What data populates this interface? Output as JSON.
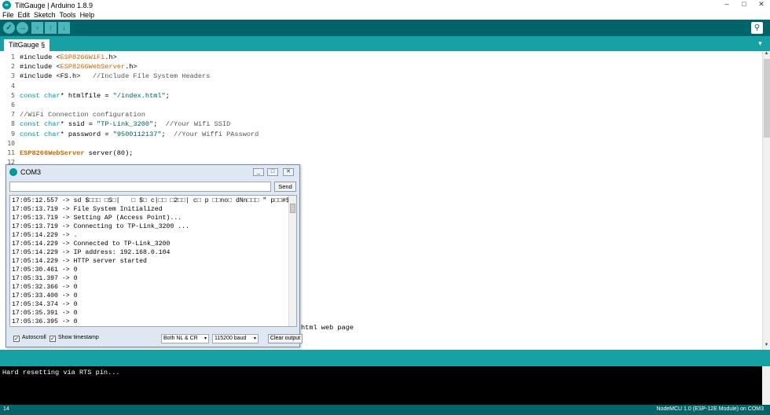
{
  "window": {
    "title": "TiltGauge | Arduino 1.8.9",
    "logo": "∞",
    "controls": [
      "–",
      "□",
      "✕"
    ]
  },
  "menu": [
    "File",
    "Edit",
    "Sketch",
    "Tools",
    "Help"
  ],
  "toolbar": {
    "verify_icon": "✓",
    "upload_icon": "→",
    "new_icon": "▫",
    "open_icon": "↑",
    "save_icon": "↓",
    "serial_monitor_icon": "⚲"
  },
  "tabs": [
    {
      "label": "TiltGauge §"
    }
  ],
  "tab_menu_icon": "▾",
  "editor": {
    "line_numbers": [
      "1",
      "2",
      "3",
      "4",
      "5",
      "6",
      "7",
      "8",
      "9",
      "10",
      "11",
      "12"
    ],
    "lines": [
      {
        "parts": [
          {
            "t": "#include <",
            "c": ""
          },
          {
            "t": "ESP8266WiFi",
            "c": "kw-lib"
          },
          {
            "t": ".h>",
            "c": ""
          }
        ]
      },
      {
        "parts": [
          {
            "t": "#include <",
            "c": ""
          },
          {
            "t": "ESP8266WebServer",
            "c": "kw-lib"
          },
          {
            "t": ".h>",
            "c": ""
          }
        ]
      },
      {
        "parts": [
          {
            "t": "#include <FS.h>   ",
            "c": ""
          },
          {
            "t": "//Include File System Headers",
            "c": "comment"
          }
        ]
      },
      {
        "parts": []
      },
      {
        "parts": [
          {
            "t": "const",
            "c": "kw-const"
          },
          {
            "t": " ",
            "c": ""
          },
          {
            "t": "char",
            "c": "kw-const"
          },
          {
            "t": "* htmlfile = ",
            "c": ""
          },
          {
            "t": "\"/index.html\"",
            "c": "str"
          },
          {
            "t": ";",
            "c": ""
          }
        ]
      },
      {
        "parts": []
      },
      {
        "parts": [
          {
            "t": "//WiFi Connection configuration",
            "c": "comment"
          }
        ]
      },
      {
        "parts": [
          {
            "t": "const",
            "c": "kw-const"
          },
          {
            "t": " ",
            "c": ""
          },
          {
            "t": "char",
            "c": "kw-const"
          },
          {
            "t": "* ssid = ",
            "c": ""
          },
          {
            "t": "\"TP-Link_3200\"",
            "c": "str"
          },
          {
            "t": ";  ",
            "c": ""
          },
          {
            "t": "//Your Wifi SSID",
            "c": "comment"
          }
        ]
      },
      {
        "parts": [
          {
            "t": "const",
            "c": "kw-const"
          },
          {
            "t": " ",
            "c": ""
          },
          {
            "t": "char",
            "c": "kw-const"
          },
          {
            "t": "* password = ",
            "c": ""
          },
          {
            "t": "\"9500112137\"",
            "c": "str"
          },
          {
            "t": ";  ",
            "c": ""
          },
          {
            "t": "//Your Wiffi PAssword",
            "c": "comment"
          }
        ]
      },
      {
        "parts": []
      },
      {
        "parts": [
          {
            "t": "ESP8266WebServer",
            "c": "kw-class"
          },
          {
            "t": " server(80);",
            "c": ""
          }
        ]
      },
      {
        "parts": []
      }
    ],
    "partial_line_text": "html web page"
  },
  "console": {
    "text": "Hard resetting via RTS pin..."
  },
  "status": {
    "line": "14",
    "board": "NodeMCU 1.0 (ESP-12E Module) on COM3"
  },
  "serial_monitor": {
    "title": "COM3",
    "controls": [
      "_",
      "□",
      "✕"
    ],
    "send_label": "Send",
    "input_value": "",
    "lines": [
      "17:05:12.557 -> sd $□□□ □S□|   □ $□ c|□□ □2□□| c□ p □□no□ dNn□□□ \" p□□#$",
      "17:05:13.719 -> File System Initialized",
      "17:05:13.719 -> Setting AP (Access Point)...",
      "17:05:13.719 -> Connecting to TP-Link_3200 ...",
      "17:05:14.229 -> .",
      "17:05:14.229 -> Connected to TP-Link_3200",
      "17:05:14.229 -> IP address: 192.168.0.104",
      "17:05:14.229 -> HTTP server started",
      "17:05:30.461 -> 0",
      "17:05:31.397 -> 0",
      "17:05:32.366 -> 0",
      "17:05:33.400 -> 0",
      "17:05:34.374 -> 0",
      "17:05:35.391 -> 0",
      "17:05:36.395 -> 0"
    ],
    "autoscroll_label": "Autoscroll",
    "autoscroll_checked": "✓",
    "timestamp_label": "Show timestamp",
    "timestamp_checked": "✓",
    "line_ending": "Both NL & CR",
    "baud": "115200 baud",
    "dropdown_arrow": "▾",
    "clear_label": "Clear output"
  }
}
